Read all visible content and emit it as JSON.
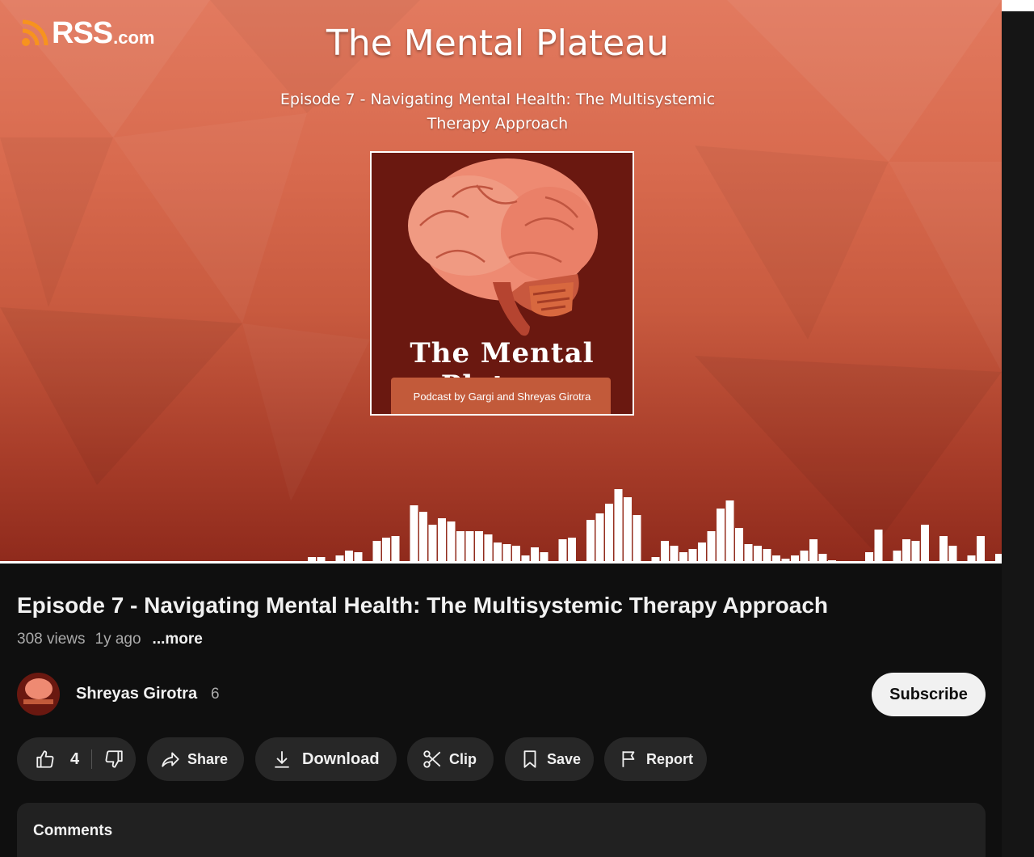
{
  "player": {
    "brand": "RSS",
    "brand_suffix": ".com",
    "show_title": "The Mental Plateau",
    "episode_caption": "Episode 7 - Navigating Mental Health: The Multisystemic Therapy Approach",
    "cover": {
      "title": "The Mental Plateau",
      "subtitle": "Podcast by Gargi and Shreyas Girotra"
    }
  },
  "video": {
    "title": "Episode 7 - Navigating Mental Health: The Multisystemic Therapy Approach",
    "views": "308 views",
    "age": "1y ago",
    "more_label": "...more"
  },
  "channel": {
    "name": "Shreyas Girotra",
    "subscribers": "6",
    "subscribe_label": "Subscribe"
  },
  "actions": {
    "likes": "4",
    "share_label": "Share",
    "download_label": "Download",
    "clip_label": "Clip",
    "save_label": "Save",
    "report_label": "Report"
  },
  "comments": {
    "label": "Comments"
  },
  "icons": [
    "rss-icon",
    "thumbs-up-icon",
    "thumbs-down-icon",
    "share-icon",
    "download-icon",
    "clip-icon",
    "save-icon",
    "report-icon"
  ],
  "colors": {
    "background": "#0f0f0f",
    "pill": "#272727",
    "subscribe_bg": "#f1f1f1",
    "accent_orange": "#e27a5f",
    "rss_orange": "#f7931e"
  }
}
